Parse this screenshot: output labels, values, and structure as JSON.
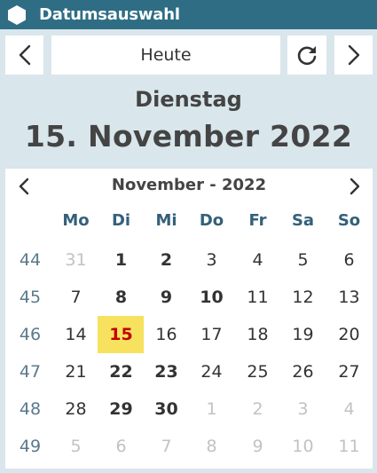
{
  "window": {
    "title": "Datumsauswahl",
    "icon": "hexagon-icon"
  },
  "toolbar": {
    "prev_icon": "chevron-left-icon",
    "today_label": "Heute",
    "refresh_icon": "refresh-icon",
    "next_icon": "chevron-right-icon"
  },
  "selected": {
    "weekday": "Dienstag",
    "date": "15. November 2022"
  },
  "calendar": {
    "title": "November - 2022",
    "weekdays": [
      "Mo",
      "Di",
      "Mi",
      "Do",
      "Fr",
      "Sa",
      "So"
    ],
    "weeks": [
      {
        "week": "44",
        "days": [
          {
            "d": "31",
            "s": "other"
          },
          {
            "d": "1",
            "s": "bold"
          },
          {
            "d": "2",
            "s": "bold"
          },
          {
            "d": "3",
            "s": ""
          },
          {
            "d": "4",
            "s": ""
          },
          {
            "d": "5",
            "s": ""
          },
          {
            "d": "6",
            "s": ""
          }
        ]
      },
      {
        "week": "45",
        "days": [
          {
            "d": "7",
            "s": ""
          },
          {
            "d": "8",
            "s": "bold"
          },
          {
            "d": "9",
            "s": "bold"
          },
          {
            "d": "10",
            "s": "bold"
          },
          {
            "d": "11",
            "s": ""
          },
          {
            "d": "12",
            "s": ""
          },
          {
            "d": "13",
            "s": ""
          }
        ]
      },
      {
        "week": "46",
        "days": [
          {
            "d": "14",
            "s": ""
          },
          {
            "d": "15",
            "s": "selected"
          },
          {
            "d": "16",
            "s": ""
          },
          {
            "d": "17",
            "s": ""
          },
          {
            "d": "18",
            "s": ""
          },
          {
            "d": "19",
            "s": ""
          },
          {
            "d": "20",
            "s": ""
          }
        ]
      },
      {
        "week": "47",
        "days": [
          {
            "d": "21",
            "s": ""
          },
          {
            "d": "22",
            "s": "bold"
          },
          {
            "d": "23",
            "s": "bold"
          },
          {
            "d": "24",
            "s": ""
          },
          {
            "d": "25",
            "s": ""
          },
          {
            "d": "26",
            "s": ""
          },
          {
            "d": "27",
            "s": ""
          }
        ]
      },
      {
        "week": "48",
        "days": [
          {
            "d": "28",
            "s": ""
          },
          {
            "d": "29",
            "s": "bold"
          },
          {
            "d": "30",
            "s": "bold"
          },
          {
            "d": "1",
            "s": "other"
          },
          {
            "d": "2",
            "s": "other"
          },
          {
            "d": "3",
            "s": "other"
          },
          {
            "d": "4",
            "s": "other"
          }
        ]
      },
      {
        "week": "49",
        "days": [
          {
            "d": "5",
            "s": "other"
          },
          {
            "d": "6",
            "s": "other"
          },
          {
            "d": "7",
            "s": "other"
          },
          {
            "d": "8",
            "s": "other"
          },
          {
            "d": "9",
            "s": "other"
          },
          {
            "d": "10",
            "s": "other"
          },
          {
            "d": "11",
            "s": "other"
          }
        ]
      }
    ]
  },
  "colors": {
    "titlebar": "#2f6d85",
    "background": "#d9e6ec",
    "selected_bg": "#f6e25e",
    "selected_text": "#c20000",
    "weekday_header": "#34607a"
  }
}
